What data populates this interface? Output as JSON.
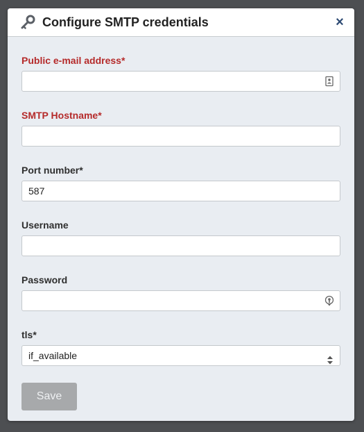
{
  "dialog": {
    "title": "Configure SMTP credentials",
    "close_label": "×"
  },
  "fields": [
    {
      "label": "Public e-mail address*",
      "value": "",
      "state": "required-missing",
      "adornment": "contact-card-icon"
    },
    {
      "label": "SMTP Hostname*",
      "value": "",
      "state": "required-missing"
    },
    {
      "label": "Port number*",
      "value": "587",
      "state": "normal"
    },
    {
      "label": "Username",
      "value": "",
      "state": "normal"
    },
    {
      "label": "Password",
      "value": "",
      "state": "normal",
      "adornment": "password-key-icon"
    }
  ],
  "tls": {
    "label": "tls*",
    "selected": "if_available"
  },
  "actions": {
    "save_label": "Save",
    "save_enabled": false
  },
  "colors": {
    "required_label": "#b52a2a",
    "close_icon": "#2d4a73",
    "save_disabled_bg": "#a7a9ab"
  }
}
